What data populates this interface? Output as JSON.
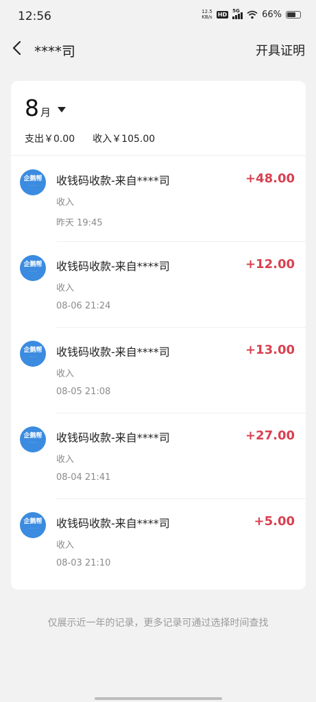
{
  "status": {
    "time": "12:56",
    "netspeed_value": "12.5",
    "netspeed_unit": "KB/s",
    "hd": "HD",
    "network": "5G",
    "battery": "66%"
  },
  "header": {
    "title": "****司",
    "certificate_label": "开具证明"
  },
  "month": {
    "number": "8",
    "unit": "月"
  },
  "summary": {
    "expense": "支出￥0.00",
    "income": "收入￥105.00"
  },
  "logo_text": "企鹅帮",
  "transactions": [
    {
      "name": "收钱码收款-来自****司",
      "type": "收入",
      "time": "昨天 19:45",
      "amount": "+48.00"
    },
    {
      "name": "收钱码收款-来自****司",
      "type": "收入",
      "time": "08-06 21:24",
      "amount": "+12.00"
    },
    {
      "name": "收钱码收款-来自****司",
      "type": "收入",
      "time": "08-05 21:08",
      "amount": "+13.00"
    },
    {
      "name": "收钱码收款-来自****司",
      "type": "收入",
      "time": "08-04 21:41",
      "amount": "+27.00"
    },
    {
      "name": "收钱码收款-来自****司",
      "type": "收入",
      "time": "08-03 21:10",
      "amount": "+5.00"
    }
  ],
  "footer_note": "仅展示近一年的记录，更多记录可通过选择时间查找",
  "colors": {
    "amount": "#d9404f",
    "logo": "#3b8be0",
    "background": "#f2f2f2"
  }
}
